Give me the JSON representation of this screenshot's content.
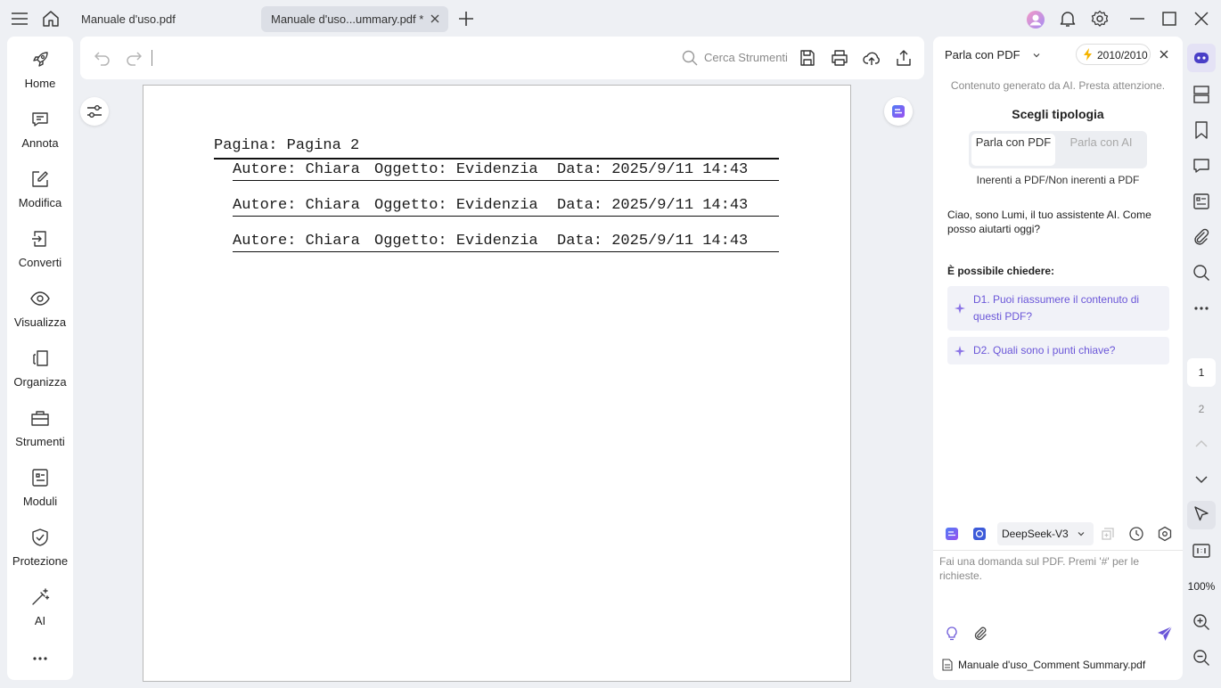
{
  "tabs": [
    {
      "label": "Manuale d'uso.pdf",
      "active": false
    },
    {
      "label": "Manuale  d'uso...ummary.pdf *",
      "active": true
    }
  ],
  "nav": [
    {
      "label": "Home",
      "icon": "rocket-icon"
    },
    {
      "label": "Annota",
      "icon": "comment-icon"
    },
    {
      "label": "Modifica",
      "icon": "edit-icon"
    },
    {
      "label": "Converti",
      "icon": "convert-icon"
    },
    {
      "label": "Visualizza",
      "icon": "eye-icon"
    },
    {
      "label": "Organizza",
      "icon": "organize-icon"
    },
    {
      "label": "Strumenti",
      "icon": "toolbox-icon"
    },
    {
      "label": "Moduli",
      "icon": "form-icon"
    },
    {
      "label": "Protezione",
      "icon": "shield-icon"
    },
    {
      "label": "AI",
      "icon": "magic-wand-icon"
    }
  ],
  "toolbar": {
    "search_placeholder": "Cerca Strumenti"
  },
  "document": {
    "title": "Pagina: Pagina 2",
    "comments": [
      {
        "author": "Autore: Chiara",
        "subject": "Oggetto: Evidenzia",
        "date": "Data: 2025/9/11 14:43"
      },
      {
        "author": "Autore: Chiara",
        "subject": "Oggetto: Evidenzia",
        "date": "Data: 2025/9/11 14:43"
      },
      {
        "author": "Autore: Chiara",
        "subject": "Oggetto: Evidenzia",
        "date": "Data: 2025/9/11 14:43"
      }
    ]
  },
  "chat": {
    "mode": "Parla con PDF",
    "credits": "2010/2010",
    "notice": "Contenuto generato da AI. Presta attenzione.",
    "choose_title": "Scegli tipologia",
    "seg_pdf": "Parla con PDF",
    "seg_ai": "Parla con AI",
    "seg_caption": "Inerenti a PDF/Non inerenti a PDF",
    "greeting": "Ciao, sono Lumi, il tuo assistente AI. Come posso aiutarti oggi?",
    "can_ask": "È possibile chiedere:",
    "questions": [
      "D1. Puoi riassumere il contenuto di questi PDF?",
      "D2. Quali sono i punti chiave?"
    ],
    "model": "DeepSeek-V3",
    "input_placeholder": "Fai una domanda sul PDF. Premi '#' per le richieste.",
    "file": "Manuale d'uso_Comment Summary.pdf"
  },
  "rail": {
    "pages": [
      "1",
      "2"
    ],
    "current_page": "1",
    "zoom": "100%"
  },
  "colors": {
    "accent": "#6a56d8",
    "background": "#eef0f4"
  }
}
